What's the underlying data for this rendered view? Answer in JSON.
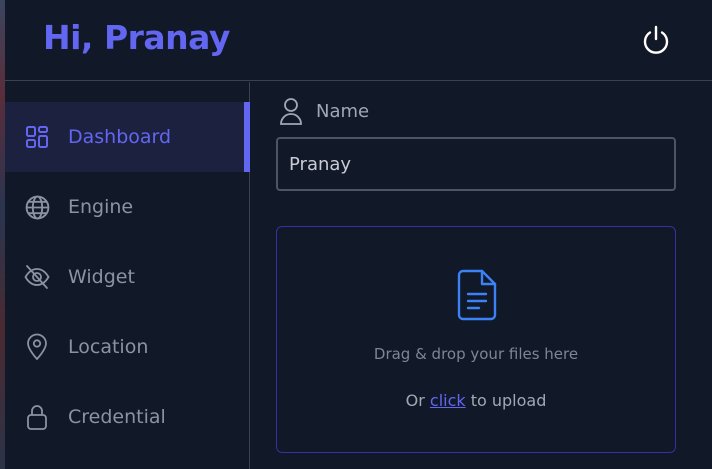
{
  "header": {
    "greeting": "Hi, Pranay",
    "power_icon": "power-icon"
  },
  "sidebar": {
    "items": [
      {
        "label": "Dashboard",
        "icon": "dashboard-grid-icon",
        "active": true
      },
      {
        "label": "Engine",
        "icon": "globe-icon",
        "active": false
      },
      {
        "label": "Widget",
        "icon": "eye-off-icon",
        "active": false
      },
      {
        "label": "Location",
        "icon": "map-pin-icon",
        "active": false
      },
      {
        "label": "Credential",
        "icon": "lock-icon",
        "active": false
      }
    ]
  },
  "main": {
    "name_field": {
      "label": "Name",
      "icon": "user-icon",
      "value": "Pranay"
    },
    "dropzone": {
      "icon": "file-text-icon",
      "drag_text": "Drag & drop your files here",
      "upload_prefix": "Or",
      "upload_link": "click",
      "upload_suffix": "to upload"
    }
  },
  "colors": {
    "background": "#111827",
    "accent": "#6366f1",
    "active_nav_bg": "#1c2140",
    "border": "#3a4150",
    "muted_text": "#8b93a3",
    "file_icon": "#3b82f6"
  }
}
